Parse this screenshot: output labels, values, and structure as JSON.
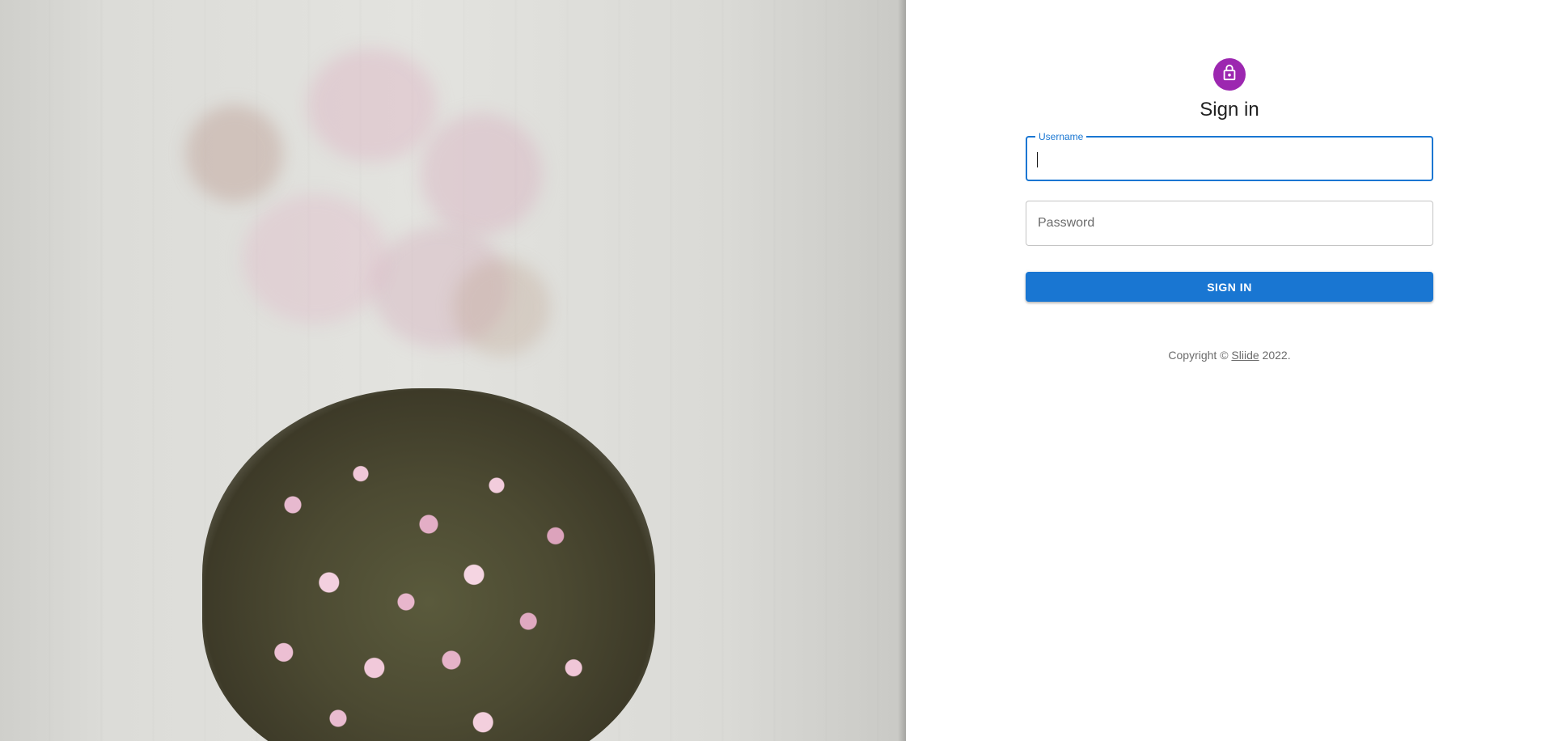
{
  "colors": {
    "accent": "#1976d2",
    "avatar_bg": "#9c27b0",
    "button_bg": "#1976d2"
  },
  "header": {
    "avatar_icon": "lock-icon",
    "title": "Sign in"
  },
  "form": {
    "username_label": "Username",
    "username_value": "",
    "password_placeholder": "Password",
    "password_value": "",
    "submit_label": "SIGN IN"
  },
  "footer": {
    "copyright_prefix": "Copyright © ",
    "brand_link": "Sliide",
    "year_suffix": " 2022."
  },
  "background": {
    "image_subject": "pink-flowers-photo"
  }
}
